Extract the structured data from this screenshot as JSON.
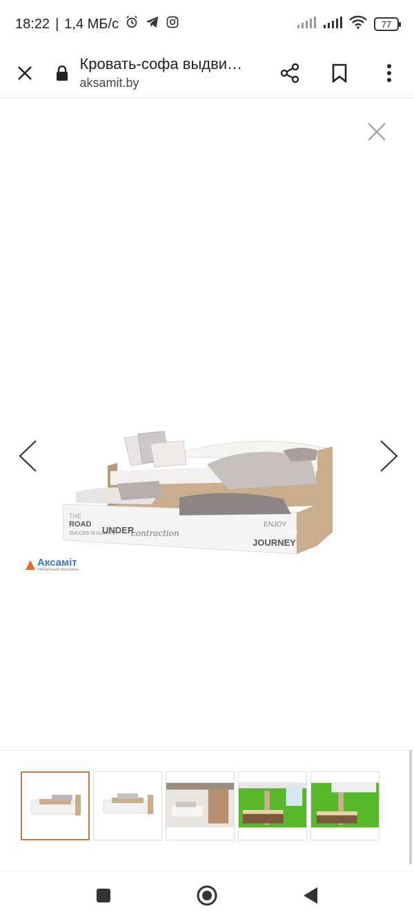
{
  "status_bar": {
    "time": "18:22",
    "separator": "|",
    "speed": "1,4 МБ/с",
    "battery": "77"
  },
  "toolbar": {
    "title": "Кровать-софа выдви…",
    "url": "aksamit.by"
  },
  "product": {
    "logo_text": "Аксамiт",
    "logo_subtext": "Мебельные магазины"
  },
  "thumbnails": [
    {
      "name": "bed-thumb-1",
      "active": true
    },
    {
      "name": "bed-thumb-2",
      "active": false
    },
    {
      "name": "bedroom-thumb",
      "active": false
    },
    {
      "name": "green-room-thumb-1",
      "active": false
    },
    {
      "name": "green-room-thumb-2",
      "active": false
    }
  ],
  "colors": {
    "accent_border": "#c47a4a",
    "wood": "#c9ad8c",
    "green_wall": "#57b82a",
    "logo_orange": "#e8672a",
    "logo_blue": "#3a7bbf"
  }
}
